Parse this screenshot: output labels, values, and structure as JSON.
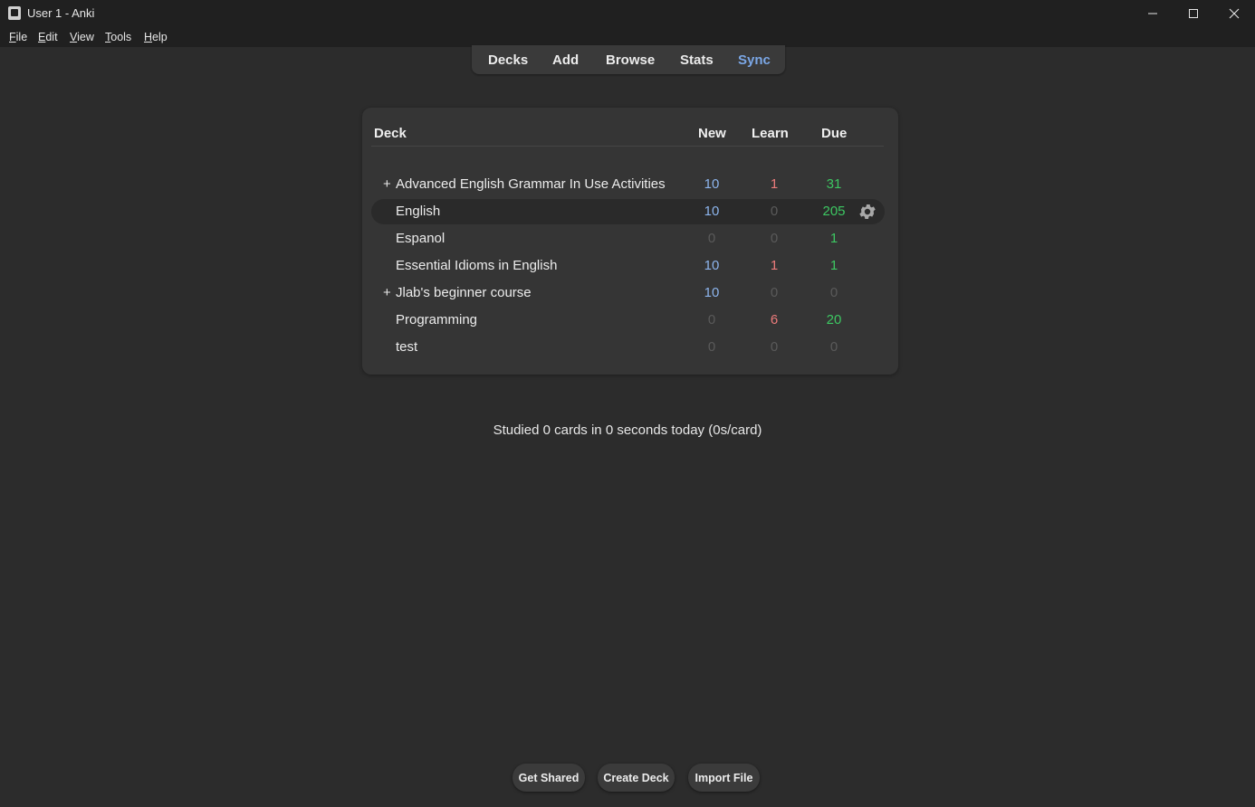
{
  "window": {
    "title": "User 1 - Anki",
    "controls": [
      "minimize-icon",
      "maximize-icon",
      "close-icon"
    ]
  },
  "menu": [
    {
      "first": "F",
      "rest": "ile"
    },
    {
      "first": "E",
      "rest": "dit"
    },
    {
      "first": "V",
      "rest": "iew"
    },
    {
      "first": "T",
      "rest": "ools"
    },
    {
      "first": "H",
      "rest": "elp"
    }
  ],
  "toolbar": {
    "decks": "Decks",
    "add": "Add",
    "browse": "Browse",
    "stats": "Stats",
    "sync": "Sync"
  },
  "deck_table": {
    "headers": {
      "deck": "Deck",
      "new": "New",
      "learn": "Learn",
      "due": "Due"
    },
    "rows": [
      {
        "expander": "+",
        "name": "Advanced English Grammar In Use Activities",
        "new": "10",
        "learn": "1",
        "due": "31"
      },
      {
        "expander": "",
        "name": "English",
        "new": "10",
        "learn": "0",
        "due": "205"
      },
      {
        "expander": "",
        "name": "Espanol",
        "new": "0",
        "learn": "0",
        "due": "1"
      },
      {
        "expander": "",
        "name": "Essential Idioms in English",
        "new": "10",
        "learn": "1",
        "due": "1"
      },
      {
        "expander": "+",
        "name": "Jlab's beginner course",
        "new": "10",
        "learn": "0",
        "due": "0"
      },
      {
        "expander": "",
        "name": "Programming",
        "new": "0",
        "learn": "6",
        "due": "20"
      },
      {
        "expander": "",
        "name": "test",
        "new": "0",
        "learn": "0",
        "due": "0"
      }
    ]
  },
  "studied": "Studied 0 cards in 0 seconds today (0s/card)",
  "bottom_buttons": {
    "get_shared": "Get Shared",
    "create_deck": "Create Deck",
    "import_file": "Import File"
  },
  "colors": {
    "new": "#8cb4ec",
    "learn": "#ec7b7b",
    "due": "#3dc762",
    "zero": "#5a5a5a",
    "sync": "#7ba7e6"
  }
}
